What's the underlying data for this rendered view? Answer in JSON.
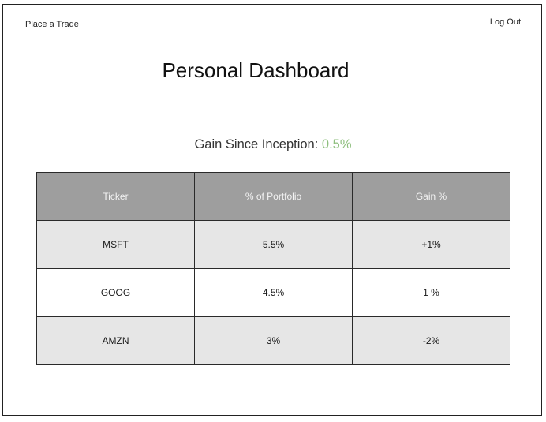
{
  "nav": {
    "place_trade": "Place a Trade",
    "logout": "Log Out"
  },
  "page": {
    "title": "Personal Dashboard"
  },
  "gain": {
    "label": "Gain Since Inception: ",
    "value": "0.5%",
    "value_color": "#8fbf7f"
  },
  "table": {
    "headers": [
      "Ticker",
      "% of Portfolio",
      "Gain %"
    ],
    "header_bg": "#9e9e9e",
    "row_shade": "#e6e6e6",
    "rows": [
      {
        "ticker": "MSFT",
        "portfolio_pct": "5.5%",
        "gain_pct": "+1%"
      },
      {
        "ticker": "GOOG",
        "portfolio_pct": "4.5%",
        "gain_pct": "1 %"
      },
      {
        "ticker": "AMZN",
        "portfolio_pct": "3%",
        "gain_pct": "-2%"
      }
    ]
  }
}
